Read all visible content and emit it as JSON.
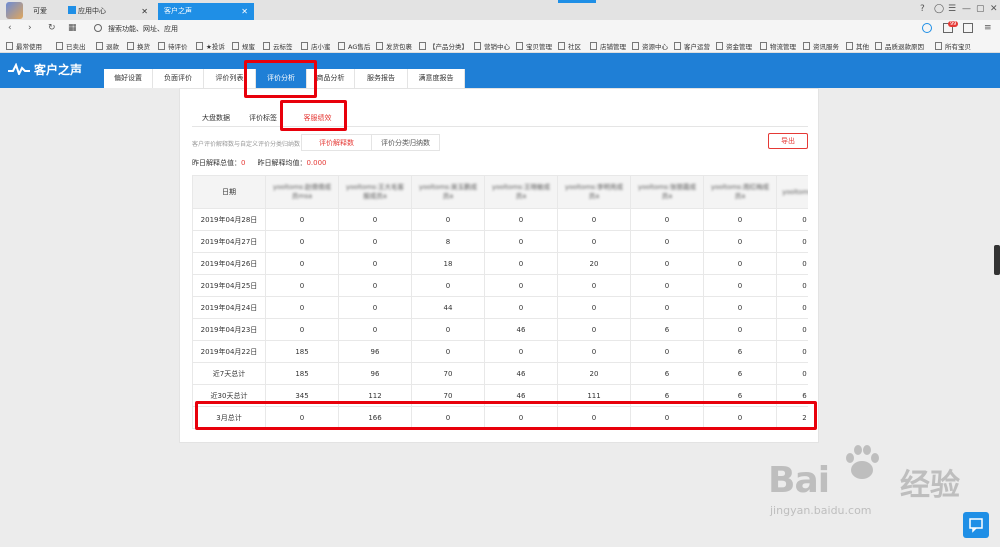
{
  "browser": {
    "tabs": [
      {
        "label": "可爱",
        "active": false
      },
      {
        "label": "应用中心",
        "active": false
      },
      {
        "label": "客户之声",
        "active": true
      }
    ],
    "address_placeholder": "搜索功能、网址、应用",
    "notification_count": "99",
    "bookmarks": [
      "最常使用",
      "已卖出",
      "退款",
      "换货",
      "待评价",
      "★投诉",
      "规蜜",
      "云标签",
      "店小蜜",
      "AG售后",
      "发货包裹",
      "【产品分类】",
      "营销中心",
      "宝贝管理",
      "社区",
      "店铺管理",
      "资源中心",
      "客户运营",
      "资金管理",
      "物流管理",
      "资讯服务",
      "其他",
      "品质退款原因",
      "所有宝贝"
    ]
  },
  "app": {
    "brand": "客户之声",
    "brand_color": "#1f7fd6",
    "main_tabs": [
      {
        "label": "偏好设置",
        "active": false
      },
      {
        "label": "负面评价",
        "active": false
      },
      {
        "label": "评价列表",
        "active": false
      },
      {
        "label": "评价分析",
        "active": true
      },
      {
        "label": "商品分析",
        "active": false
      },
      {
        "label": "服务报告",
        "active": false
      },
      {
        "label": "满意度报告",
        "active": false
      }
    ],
    "sub_tabs": [
      {
        "label": "大盘数据",
        "active": false
      },
      {
        "label": "评价标签",
        "active": false
      },
      {
        "label": "客服绩效",
        "active": true
      }
    ],
    "hint": "客户评价解释数与自定义评价分类归纳数",
    "filter_tabs": [
      {
        "label": "评价解释数",
        "active": true
      },
      {
        "label": "评价分类归纳数",
        "active": false
      }
    ],
    "export_label": "导出",
    "summary": {
      "total_label": "昨日解释总值：",
      "total_value": "0",
      "avg_label": "昨日解释均值：",
      "avg_value": "0.000"
    },
    "table": {
      "date_header": "日期",
      "agent_headers": [
        "yooltoms:赵倩倩成员msa",
        "yooltoms:王大毛客服成员a",
        "yooltoms:吴玉鹏成员a",
        "yooltoms:王晓敏成员a",
        "yooltoms:李明亮成员a",
        "yooltoms:张丽霞成员a",
        "yooltoms:周红梅成员a",
        "yooltoms:刘成员"
      ],
      "rows": [
        {
          "date": "2019年04月28日",
          "values": [
            "0",
            "0",
            "0",
            "0",
            "0",
            "0",
            "0",
            "0"
          ]
        },
        {
          "date": "2019年04月27日",
          "values": [
            "0",
            "0",
            "8",
            "0",
            "0",
            "0",
            "0",
            "0"
          ]
        },
        {
          "date": "2019年04月26日",
          "values": [
            "0",
            "0",
            "18",
            "0",
            "20",
            "0",
            "0",
            "0"
          ]
        },
        {
          "date": "2019年04月25日",
          "values": [
            "0",
            "0",
            "0",
            "0",
            "0",
            "0",
            "0",
            "0"
          ]
        },
        {
          "date": "2019年04月24日",
          "values": [
            "0",
            "0",
            "44",
            "0",
            "0",
            "0",
            "0",
            "0"
          ]
        },
        {
          "date": "2019年04月23日",
          "values": [
            "0",
            "0",
            "0",
            "46",
            "0",
            "6",
            "0",
            "0"
          ]
        },
        {
          "date": "2019年04月22日",
          "values": [
            "185",
            "96",
            "0",
            "0",
            "0",
            "0",
            "6",
            "0"
          ]
        },
        {
          "date": "近7天总计",
          "values": [
            "185",
            "96",
            "70",
            "46",
            "20",
            "6",
            "6",
            "0"
          ]
        },
        {
          "date": "近30天总计",
          "values": [
            "345",
            "112",
            "70",
            "46",
            "111",
            "6",
            "6",
            "6"
          ]
        },
        {
          "date": "3月总计",
          "values": [
            "0",
            "166",
            "0",
            "0",
            "0",
            "0",
            "0",
            "2"
          ]
        }
      ]
    }
  },
  "watermark": {
    "text": "Bai",
    "text2": "经验",
    "url": "jingyan.baidu.com"
  }
}
